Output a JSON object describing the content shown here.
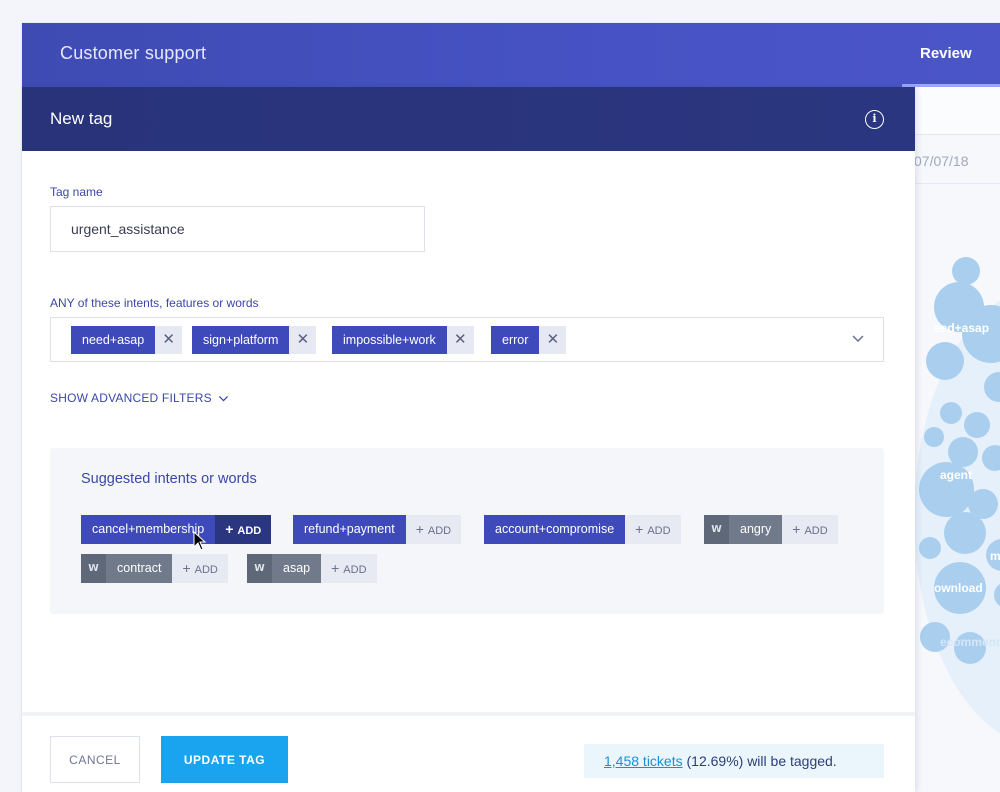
{
  "app": {
    "title": "Customer support",
    "review_tab": "Review"
  },
  "background": {
    "date": "07/07/18",
    "bubble_labels": [
      "eed+asap",
      "agent",
      "mail",
      "ownload",
      "ecommend"
    ]
  },
  "modal": {
    "title": "New tag",
    "info_icon": "info-icon",
    "tag_name_label": "Tag name",
    "tag_name_value": "urgent_assistance",
    "any_label": "ANY of these intents, features or words",
    "selected_chips": [
      {
        "label": "need+asap"
      },
      {
        "label": "sign+platform"
      },
      {
        "label": "impossible+work"
      },
      {
        "label": "error"
      }
    ],
    "advanced_filters": "SHOW ADVANCED FILTERS",
    "suggested": {
      "title": "Suggested intents or words",
      "add_label": "ADD",
      "word_badge": "W",
      "items": [
        {
          "label": "cancel+membership",
          "type": "intent"
        },
        {
          "label": "refund+payment",
          "type": "intent"
        },
        {
          "label": "account+compromise",
          "type": "intent"
        },
        {
          "label": "angry",
          "type": "word"
        },
        {
          "label": "contract",
          "type": "word"
        },
        {
          "label": "asap",
          "type": "word"
        }
      ]
    },
    "footer": {
      "cancel": "CANCEL",
      "update": "UPDATE TAG",
      "tickets_link": "1,458 tickets",
      "tickets_rest": " (12.69%) will be tagged."
    }
  },
  "colors": {
    "topbar": "#4753c4",
    "modal_header": "#28337a",
    "chip": "#3f4aba",
    "primary_button": "#1aa4ef"
  }
}
